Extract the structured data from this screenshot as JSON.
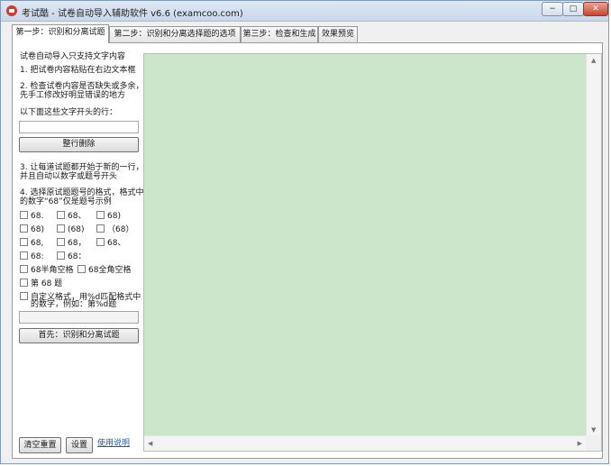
{
  "window": {
    "title": "考试酷 - 试卷自动导入辅助软件 v6.6 (examcoo.com)"
  },
  "controls": {
    "minimize": "−",
    "maximize": "□",
    "close": "✕"
  },
  "tabs": [
    {
      "label": "第一步：识别和分离试题"
    },
    {
      "label": "第二步：识别和分离选择题的选项"
    },
    {
      "label": "第三步：检查和生成"
    },
    {
      "label": "效果预览"
    }
  ],
  "step1": {
    "title": "试卷自动导入只支持文字内容",
    "item1": "1. 把试卷内容粘贴在右边文本框",
    "item2_line1": "2. 检查试卷内容是否缺失或多余，",
    "item2_line2": "先手工修改好明显错误的地方",
    "prefix_label": "以下面这些文字开头的行：",
    "prefix_value": "",
    "delete_rows_button": "整行删除",
    "item3_line1": "3. 让每道试题都开始于新的一行，",
    "item3_line2": "并且自动以数字或题号开头",
    "item4_line1": "4. 选择原试题题号的格式，格式中",
    "item4_line2": "的数字“68”仅是题号示例",
    "formats": [
      [
        "68.",
        "68、",
        "68)"
      ],
      [
        "68)",
        "(68)",
        "（68）"
      ],
      [
        "68,",
        "68，",
        "68、"
      ],
      [
        "68:",
        "68："
      ]
    ],
    "space_half": "68半角空格",
    "space_full": "68全角空格",
    "chapter_format": "第 68 题",
    "custom_line1": "自定义格式，用%d匹配格式中",
    "custom_line2": "的数字，例如：第%d题",
    "custom_value": "",
    "identify_button": "首先：识别和分离试题"
  },
  "footer": {
    "clear_button": "清空重置",
    "settings_button": "设置",
    "help_link": "使用说明"
  },
  "editor": {
    "content": "",
    "background": "#cce6cc"
  }
}
